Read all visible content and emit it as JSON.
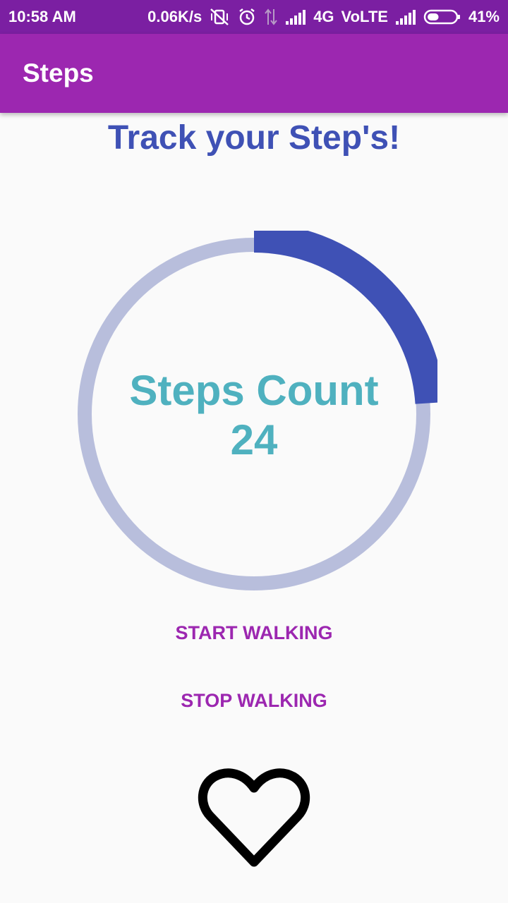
{
  "status_bar": {
    "time": "10:58 AM",
    "net_speed": "0.06K/s",
    "network": "4G",
    "volte": "VoLTE",
    "battery_percent": "41%",
    "battery_level": 0.41
  },
  "app_bar": {
    "title": "Steps"
  },
  "main": {
    "heading": "Track your Step's!",
    "steps_label": "Steps Count",
    "steps_value": "24",
    "start_button": "START WALKING",
    "stop_button": "STOP WALKING"
  },
  "progress": {
    "fraction": 0.24,
    "track_color": "#b8bedc",
    "fill_color": "#3f51b5"
  },
  "colors": {
    "primary": "#9c27b0",
    "primary_dark": "#7b1fa2",
    "heading": "#3f51b5",
    "count_text": "#4fb1bf"
  },
  "icons": {
    "heart": "heart-outline-icon"
  }
}
